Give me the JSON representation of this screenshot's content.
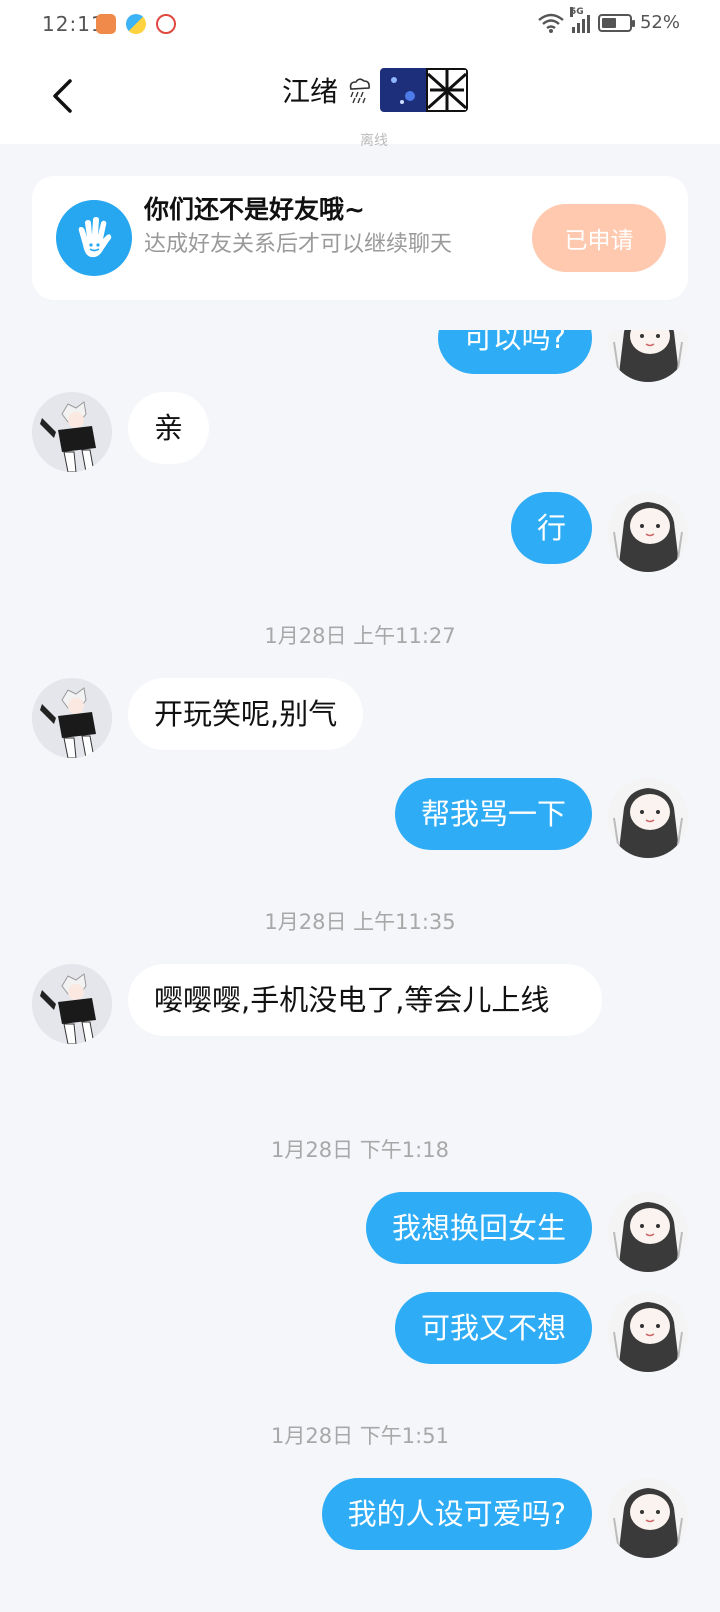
{
  "status_bar": {
    "time": "12:11",
    "network": "5G",
    "battery": "52%",
    "battery_level": 0.52
  },
  "header": {
    "back_icon": "chevron-left-icon",
    "title": "江绪",
    "subtitle": "离线"
  },
  "friend_card": {
    "icon": "waving-hand-icon",
    "title": "你们还不是好友哦~",
    "description": "达成好友关系后才可以继续聊天",
    "button_label": "已申请"
  },
  "messages": [
    {
      "type": "out",
      "text": "可以吗?"
    },
    {
      "type": "in",
      "text": "亲"
    },
    {
      "type": "out",
      "text": "行"
    },
    {
      "type": "time",
      "text": "1月28日 上午11:27"
    },
    {
      "type": "in",
      "text": "开玩笑呢,别气"
    },
    {
      "type": "out",
      "text": "帮我骂一下"
    },
    {
      "type": "time",
      "text": "1月28日 上午11:35"
    },
    {
      "type": "in",
      "text": "嘤嘤嘤,手机没电了,等会儿上线"
    },
    {
      "type": "time",
      "text": "1月28日 下午1:18"
    },
    {
      "type": "out",
      "text": "我想换回女生"
    },
    {
      "type": "out",
      "text": "可我又不想"
    },
    {
      "type": "time",
      "text": "1月28日 下午1:51"
    },
    {
      "type": "out",
      "text": "我的人设可爱吗?"
    }
  ],
  "colors": {
    "outgoing_bubble": "#2eacf5",
    "incoming_bubble": "#ffffff",
    "background": "#f4f6f9",
    "applied_button": "#ffc9b0"
  }
}
